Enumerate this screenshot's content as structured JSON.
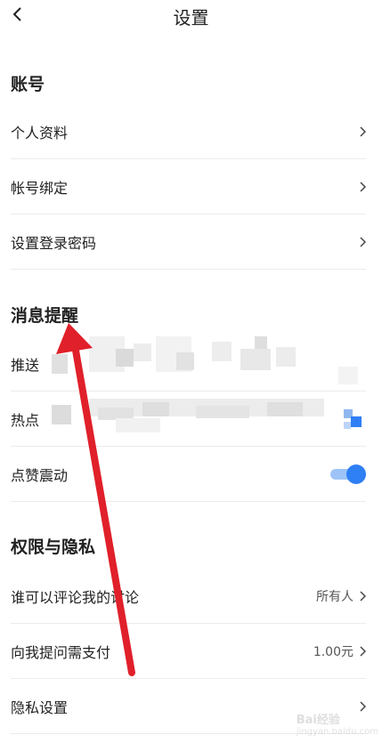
{
  "header": {
    "title": "设置"
  },
  "sections": {
    "account": {
      "title": "账号",
      "items": [
        {
          "label": "个人资料"
        },
        {
          "label": "帐号绑定"
        },
        {
          "label": "设置登录密码"
        }
      ]
    },
    "notifications": {
      "title": "消息提醒",
      "items": [
        {
          "label": "推送"
        },
        {
          "label": "热点"
        },
        {
          "label": "点赞震动",
          "toggle_on": true
        }
      ]
    },
    "privacy": {
      "title": "权限与隐私",
      "items": [
        {
          "label": "谁可以评论我的讨论",
          "value": "所有人"
        },
        {
          "label": "向我提问需支付",
          "value": "1.00元"
        },
        {
          "label": "隐私设置"
        }
      ]
    }
  },
  "watermark": {
    "text": "Bai经验",
    "sub": "jingyan.baidu.com"
  },
  "colors": {
    "accent": "#2f7ff5",
    "toggle_track": "#9ec4f7",
    "arrow": "#e0202a",
    "divider": "#ececec"
  },
  "icons": {
    "back": "chevron-left-icon",
    "row_arrow": "chevron-right-icon",
    "annotation": "red-arrow-annotation"
  }
}
